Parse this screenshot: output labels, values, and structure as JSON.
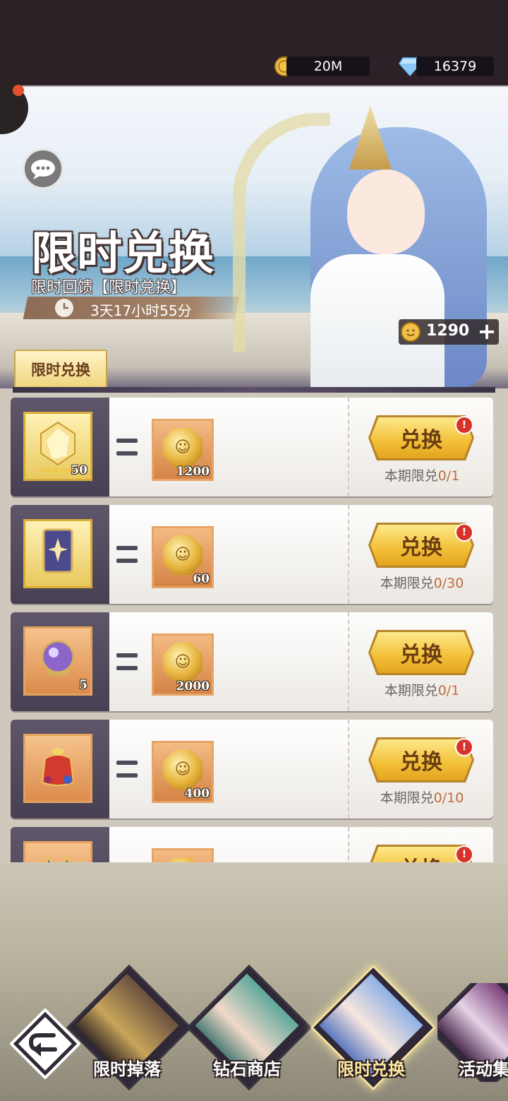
{
  "resources": {
    "gold": "20M",
    "diamond": "16379"
  },
  "hero": {
    "title": "限时兑换",
    "subtitle": "限时回馈【限时兑换】",
    "timer": "3天17小时55分",
    "token_count": "1290",
    "token_plus": "+"
  },
  "tab": {
    "label": "限时兑换"
  },
  "rows": [
    {
      "item_qty": "50",
      "cost_qty": "1200",
      "button": "兑换",
      "limit_label": "本期限兑",
      "limit_count": "0/1",
      "badge": "!"
    },
    {
      "item_qty": "",
      "cost_qty": "60",
      "button": "兑换",
      "limit_label": "本期限兑",
      "limit_count": "0/30",
      "badge": "!"
    },
    {
      "item_qty": "5",
      "cost_qty": "2000",
      "button": "兑换",
      "limit_label": "本期限兑",
      "limit_count": "0/1",
      "badge": ""
    },
    {
      "item_qty": "",
      "cost_qty": "400",
      "button": "兑换",
      "limit_label": "本期限兑",
      "limit_count": "0/10",
      "badge": "!"
    },
    {
      "item_qty": "",
      "cost_qty": "",
      "button": "兑换",
      "limit_label": "",
      "limit_count": "",
      "badge": "!"
    }
  ],
  "nav": [
    {
      "label": "限时掉落"
    },
    {
      "label": "钻石商店"
    },
    {
      "label": "限时兑换"
    },
    {
      "label": "活动集"
    }
  ],
  "colors": {
    "topbar": "#2b2126",
    "button_gold": "#f2bf36",
    "limit_accent": "#c06a3a",
    "badge_red": "#d8322a"
  }
}
